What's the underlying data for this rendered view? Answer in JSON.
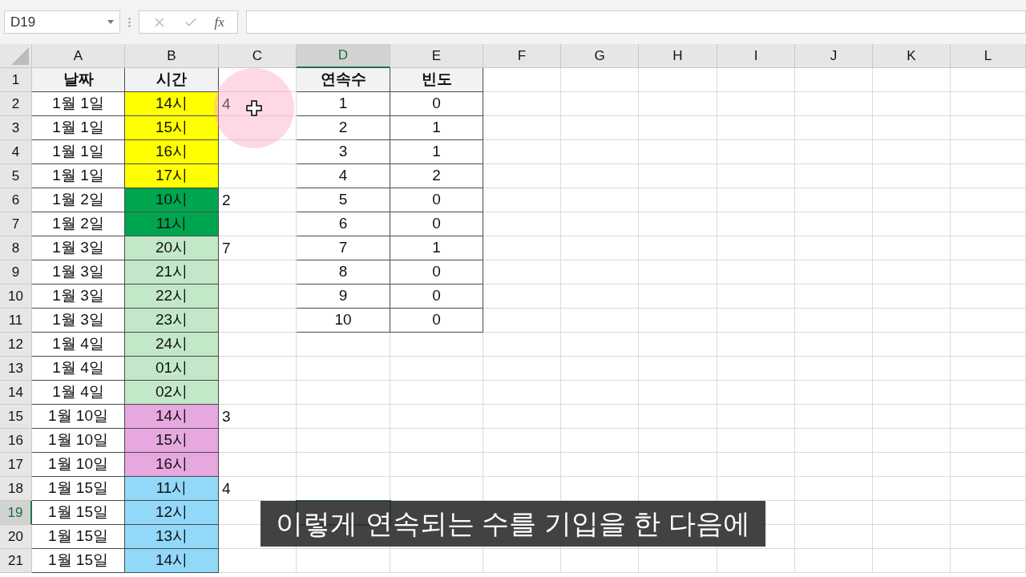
{
  "name_box": "D19",
  "formula_bar": {
    "function_label": "fx"
  },
  "columns": [
    {
      "label": "A",
      "selected": false
    },
    {
      "label": "B",
      "selected": false
    },
    {
      "label": "C",
      "selected": false
    },
    {
      "label": "D",
      "selected": true
    },
    {
      "label": "E",
      "selected": false
    },
    {
      "label": "F",
      "selected": false
    },
    {
      "label": "G",
      "selected": false
    },
    {
      "label": "H",
      "selected": false
    },
    {
      "label": "I",
      "selected": false
    },
    {
      "label": "J",
      "selected": false
    },
    {
      "label": "K",
      "selected": false
    },
    {
      "label": "L",
      "selected": false
    }
  ],
  "rows": [
    {
      "number": "1",
      "selected": false,
      "kind": "header",
      "date": "날짜",
      "time": "시간",
      "count": "연속수",
      "freq": "빈도"
    },
    {
      "number": "2",
      "selected": false,
      "kind": "data",
      "date": "1월 1일",
      "time": "14시",
      "color": "#ffff00",
      "note": "4",
      "count": "1",
      "freq": "0"
    },
    {
      "number": "3",
      "selected": false,
      "kind": "data",
      "date": "1월 1일",
      "time": "15시",
      "color": "#ffff00",
      "count": "2",
      "freq": "1"
    },
    {
      "number": "4",
      "selected": false,
      "kind": "data",
      "date": "1월 1일",
      "time": "16시",
      "color": "#ffff00",
      "count": "3",
      "freq": "1"
    },
    {
      "number": "5",
      "selected": false,
      "kind": "data",
      "date": "1월 1일",
      "time": "17시",
      "color": "#ffff00",
      "count": "4",
      "freq": "2"
    },
    {
      "number": "6",
      "selected": false,
      "kind": "data",
      "date": "1월 2일",
      "time": "10시",
      "color": "#00a550",
      "note": "2",
      "count": "5",
      "freq": "0"
    },
    {
      "number": "7",
      "selected": false,
      "kind": "data",
      "date": "1월 2일",
      "time": "11시",
      "color": "#00a550",
      "count": "6",
      "freq": "0"
    },
    {
      "number": "8",
      "selected": false,
      "kind": "data",
      "date": "1월 3일",
      "time": "20시",
      "color": "#c3e8c8",
      "note": "7",
      "count": "7",
      "freq": "1"
    },
    {
      "number": "9",
      "selected": false,
      "kind": "data",
      "date": "1월 3일",
      "time": "21시",
      "color": "#c3e8c8",
      "count": "8",
      "freq": "0"
    },
    {
      "number": "10",
      "selected": false,
      "kind": "data",
      "date": "1월 3일",
      "time": "22시",
      "color": "#c3e8c8",
      "count": "9",
      "freq": "0"
    },
    {
      "number": "11",
      "selected": false,
      "kind": "data",
      "date": "1월 3일",
      "time": "23시",
      "color": "#c3e8c8",
      "count": "10",
      "freq": "0"
    },
    {
      "number": "12",
      "selected": false,
      "kind": "data",
      "date": "1월 4일",
      "time": "24시",
      "color": "#c3e8c8"
    },
    {
      "number": "13",
      "selected": false,
      "kind": "data",
      "date": "1월 4일",
      "time": "01시",
      "color": "#c3e8c8"
    },
    {
      "number": "14",
      "selected": false,
      "kind": "data",
      "date": "1월 4일",
      "time": "02시",
      "color": "#c3e8c8"
    },
    {
      "number": "15",
      "selected": false,
      "kind": "data",
      "date": "1월 10일",
      "time": "14시",
      "color": "#e6a8de",
      "note": "3"
    },
    {
      "number": "16",
      "selected": false,
      "kind": "data",
      "date": "1월 10일",
      "time": "15시",
      "color": "#e6a8de"
    },
    {
      "number": "17",
      "selected": false,
      "kind": "data",
      "date": "1월 10일",
      "time": "16시",
      "color": "#e6a8de"
    },
    {
      "number": "18",
      "selected": false,
      "kind": "data",
      "date": "1월 15일",
      "time": "11시",
      "color": "#92d8f8",
      "note": "4"
    },
    {
      "number": "19",
      "selected": true,
      "kind": "data",
      "date": "1월 15일",
      "time": "12시",
      "color": "#92d8f8"
    },
    {
      "number": "20",
      "selected": false,
      "kind": "data",
      "date": "1월 15일",
      "time": "13시",
      "color": "#92d8f8"
    },
    {
      "number": "21",
      "selected": false,
      "kind": "data",
      "date": "1월 15일",
      "time": "14시",
      "color": "#92d8f8"
    }
  ],
  "subtitle": "이렇게 연속되는 수를 기입을 한 다음에"
}
